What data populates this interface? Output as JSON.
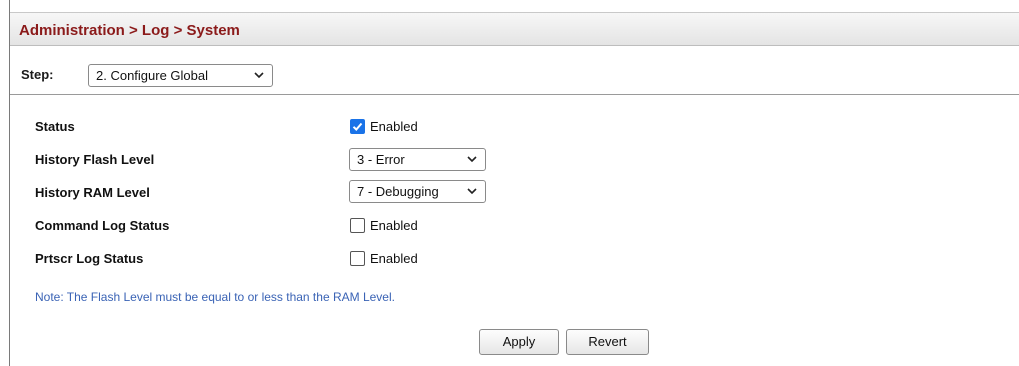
{
  "header": {
    "title": "Administration > Log > System"
  },
  "step": {
    "label": "Step:",
    "selected": "2. Configure Global"
  },
  "settings": {
    "status": {
      "label": "Status",
      "checked": true,
      "text": "Enabled"
    },
    "history_flash_level": {
      "label": "History Flash Level",
      "selected": "3 - Error"
    },
    "history_ram_level": {
      "label": "History RAM Level",
      "selected": "7 - Debugging"
    },
    "command_log_status": {
      "label": "Command Log Status",
      "checked": false,
      "text": "Enabled"
    },
    "prtscr_log_status": {
      "label": "Prtscr Log Status",
      "checked": false,
      "text": "Enabled"
    }
  },
  "note": "Note: The Flash Level must be equal to or less than the RAM Level.",
  "actions": {
    "apply": "Apply",
    "revert": "Revert"
  },
  "colors": {
    "title": "#8b1a1a",
    "note": "#3a63b5",
    "checkbox_checked": "#1a73e8"
  }
}
